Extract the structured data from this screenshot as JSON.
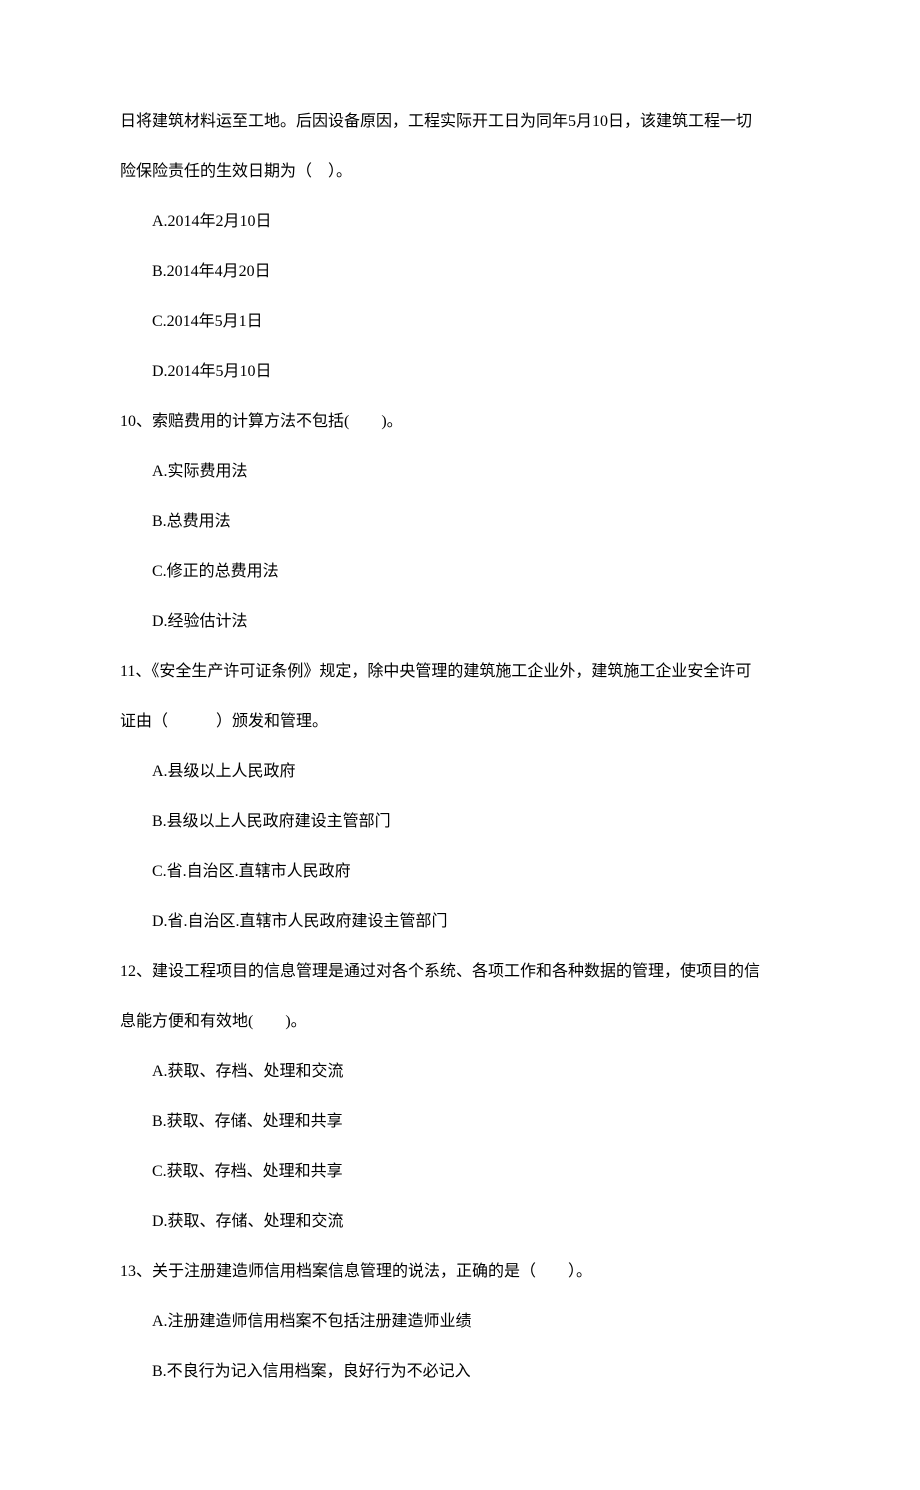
{
  "q9": {
    "stem_line1": "日将建筑材料运至工地。后因设备原因，工程实际开工日为同年5月10日，该建筑工程一切",
    "stem_line2": "险保险责任的生效日期为（　）。",
    "options": {
      "a": "A.2014年2月10日",
      "b": "B.2014年4月20日",
      "c": "C.2014年5月1日",
      "d": "D.2014年5月10日"
    }
  },
  "q10": {
    "stem": "10、索赔费用的计算方法不包括(　　)。",
    "options": {
      "a": "A.实际费用法",
      "b": "B.总费用法",
      "c": "C.修正的总费用法",
      "d": "D.经验估计法"
    }
  },
  "q11": {
    "stem_line1": "11、《安全生产许可证条例》规定，除中央管理的建筑施工企业外，建筑施工企业安全许可",
    "stem_line2": "证由（　　　）颁发和管理。",
    "options": {
      "a": "A.县级以上人民政府",
      "b": "B.县级以上人民政府建设主管部门",
      "c": "C.省.自治区.直辖市人民政府",
      "d": "D.省.自治区.直辖市人民政府建设主管部门"
    }
  },
  "q12": {
    "stem_line1": "12、建设工程项目的信息管理是通过对各个系统、各项工作和各种数据的管理，使项目的信",
    "stem_line2": "息能方便和有效地(　　)。",
    "options": {
      "a": "A.获取、存档、处理和交流",
      "b": "B.获取、存储、处理和共享",
      "c": "C.获取、存档、处理和共享",
      "d": "D.获取、存储、处理和交流"
    }
  },
  "q13": {
    "stem": "13、关于注册建造师信用档案信息管理的说法，正确的是（　　）。",
    "options": {
      "a": "A.注册建造师信用档案不包括注册建造师业绩",
      "b": "B.不良行为记入信用档案，良好行为不必记入"
    }
  }
}
